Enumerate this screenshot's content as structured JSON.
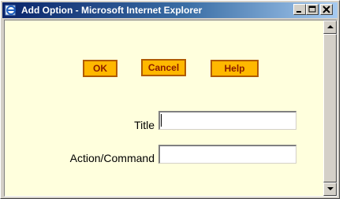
{
  "window": {
    "title": "Add Option - Microsoft Internet Explorer",
    "icon": "internet-explorer-icon"
  },
  "controls": {
    "minimize": "minimize-icon",
    "maximize": "maximize-icon",
    "close": "close-icon"
  },
  "buttons": {
    "ok": "OK",
    "cancel": "Cancel",
    "help": "Help"
  },
  "form": {
    "title_label": "Title",
    "title_value": "",
    "action_label": "Action/Command",
    "action_value": ""
  },
  "colors": {
    "background": "#ffffdd",
    "button_fill": "#ffb800",
    "button_border": "#b05a00",
    "button_text": "#8b1a00"
  }
}
